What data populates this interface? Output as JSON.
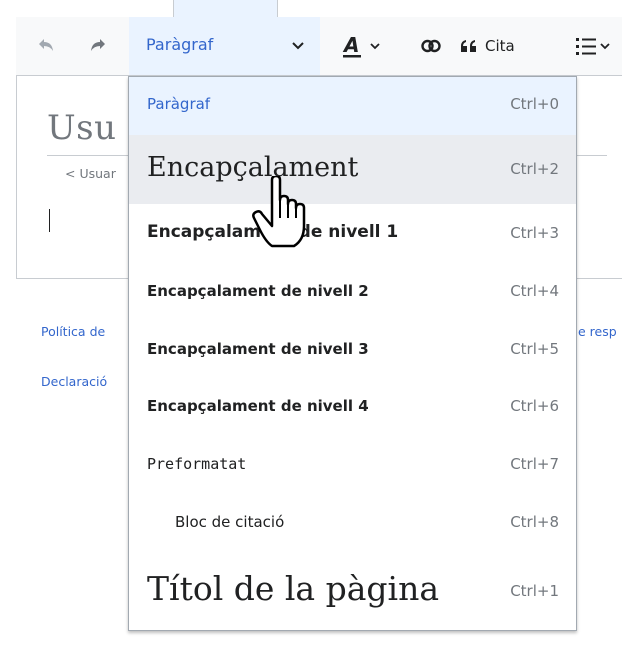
{
  "toolbar": {
    "undo_icon": "undo-icon",
    "redo_icon": "redo-icon",
    "paragraph_label": "Paràgraf",
    "text_style_icon": "text-style-icon",
    "link_icon": "link-icon",
    "cite_label": "Cita",
    "list_icon": "bullet-list-icon"
  },
  "page": {
    "title_fragment": "Usu",
    "back_link_fragment": "< Usuar",
    "footer_policy_fragment": "Política de",
    "footer_declaration_fragment": "Declaració",
    "footer_right_fragment": "e resp"
  },
  "menu": {
    "items": [
      {
        "label": "Paràgraf",
        "shortcut": "Ctrl+0",
        "state": "selected"
      },
      {
        "label": "Encapçalament",
        "shortcut": "Ctrl+2",
        "state": "hover"
      },
      {
        "label": "Encapçalament de nivell 1",
        "shortcut": "Ctrl+3"
      },
      {
        "label": "Encapçalament de nivell 2",
        "shortcut": "Ctrl+4"
      },
      {
        "label": "Encapçalament de nivell 3",
        "shortcut": "Ctrl+5"
      },
      {
        "label": "Encapçalament de nivell 4",
        "shortcut": "Ctrl+6"
      },
      {
        "label": "Preformatat",
        "shortcut": "Ctrl+7"
      },
      {
        "label": "Bloc de citació",
        "shortcut": "Ctrl+8"
      },
      {
        "label": "Títol de la pàgina",
        "shortcut": "Ctrl+1"
      }
    ]
  },
  "colors": {
    "accent": "#3366cc",
    "selected_bg": "#eaf3ff",
    "hover_bg": "#eaecf0",
    "border": "#c8ccd1"
  }
}
